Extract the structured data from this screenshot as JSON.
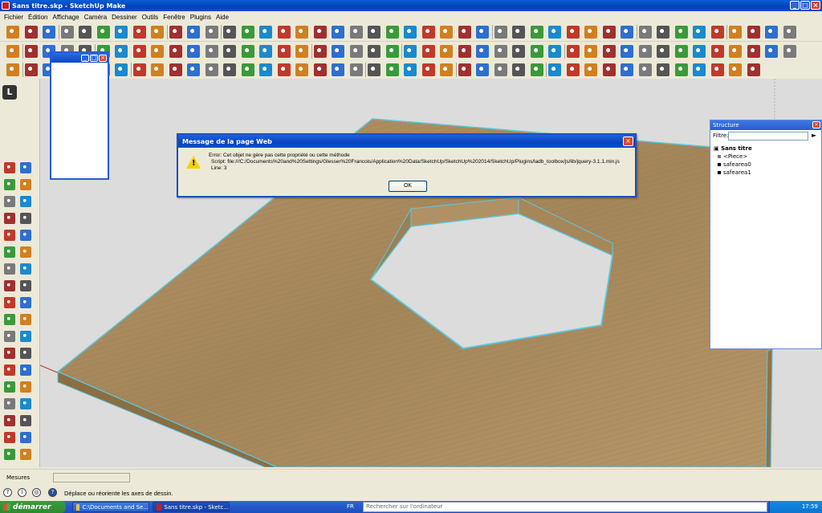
{
  "window": {
    "title": "Sans titre.skp - SketchUp Make"
  },
  "menu": [
    "Fichier",
    "Édition",
    "Affichage",
    "Caméra",
    "Dessiner",
    "Outils",
    "Fenêtre",
    "Plugins",
    "Aide"
  ],
  "dialog": {
    "title": "Message de la page Web",
    "lines": [
      "Error: Cet objet ne gère pas cette propriété ou cette méthode",
      "Script: file:///C:/Documents%20and%20Settings/Glesser%20Francois/Application%20Data/SketchUp/SketchUp%202014/SketchUp/Plugins/ladb_toolbox/js/lib/jquery-3.1.1.min.js",
      "Line: 3"
    ],
    "ok_label": "OK"
  },
  "structure": {
    "title": "Structure",
    "filter_label": "Filtre:",
    "root": "Sans titre",
    "items": [
      "<Piece>",
      "safearea0",
      "safearea1"
    ]
  },
  "statusbar": {
    "measure_label": "Mesures",
    "hint": "Déplace ou réoriente les axes de dessin."
  },
  "taskbar": {
    "start_label": "démarrer",
    "tasks": [
      "C:\\Documents and Se...",
      "Sans titre.skp - Sketc..."
    ],
    "lang": "FR",
    "search_placeholder": "Rechercher sur l'ordinateur",
    "clock": "17:59"
  },
  "colors": {
    "wood": "#a88a5c",
    "wood_dark": "#8a6e44",
    "edge_highlight": "#5bc8e0",
    "background": "#dcdcdc"
  }
}
